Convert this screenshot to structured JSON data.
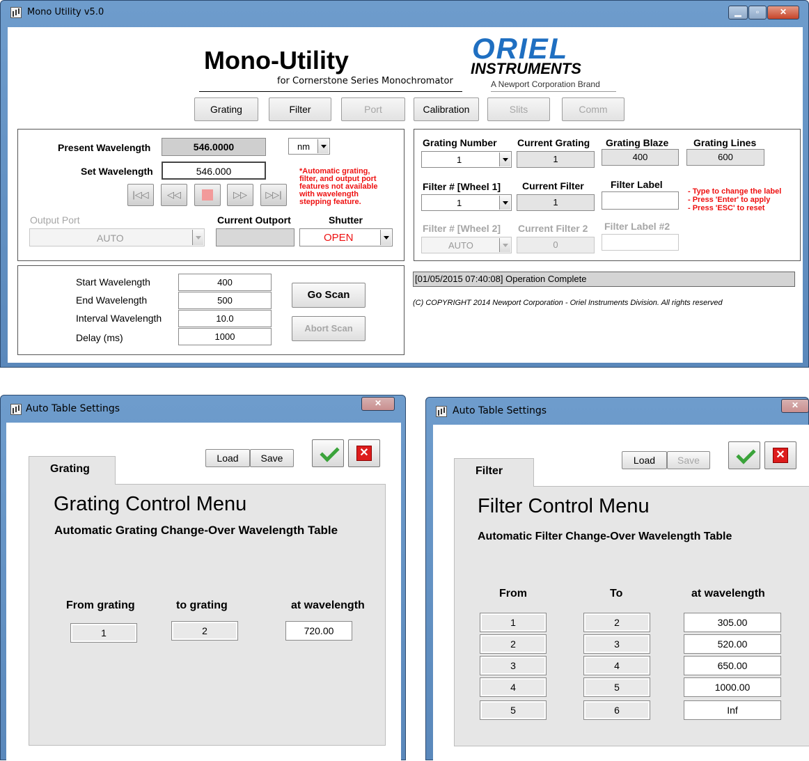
{
  "main_window": {
    "title": "Mono Utility v5.0",
    "header": {
      "title": "Mono-Utility",
      "subtitle": "for Cornerstone Series Monochromator"
    },
    "brand": {
      "name1": "ORIEL",
      "name2": "INSTRUMENTS",
      "tagline": "A Newport Corporation Brand"
    },
    "nav": [
      "Grating",
      "Filter",
      "Port",
      "Calibration",
      "Slits",
      "Comm"
    ],
    "wavelength": {
      "present_label": "Present Wavelength",
      "present_value": "546.0000",
      "unit": "nm",
      "set_label": "Set Wavelength",
      "set_value": "546.000",
      "note": "*Automatic grating, filter, and output port features not available with wavelength stepping feature.",
      "nav_icons": [
        "first-icon",
        "rewind-icon",
        "stop-icon",
        "forward-icon",
        "last-icon"
      ],
      "output_port_label": "Output Port",
      "output_port_value": "AUTO",
      "current_outport_label": "Current Outport",
      "current_outport_value": "",
      "shutter_label": "Shutter",
      "shutter_value": "OPEN"
    },
    "scan": {
      "start_label": "Start Wavelength",
      "start_value": "400",
      "end_label": "End Wavelength",
      "end_value": "500",
      "interval_label": "Interval Wavelength",
      "interval_value": "10.0",
      "delay_label": "Delay (ms)",
      "delay_value": "1000",
      "go_label": "Go Scan",
      "abort_label": "Abort Scan"
    },
    "grating": {
      "number_label": "Grating Number",
      "number_value": "1",
      "current_label": "Current Grating",
      "current_value": "1",
      "blaze_label": "Grating Blaze",
      "blaze_value": "400",
      "lines_label": "Grating Lines",
      "lines_value": "600"
    },
    "filter": {
      "wheel1_label": "Filter # [Wheel 1]",
      "wheel1_value": "1",
      "current_label": "Current Filter",
      "current_value": "1",
      "filter_label_label": "Filter Label",
      "filter_label_value": "",
      "hints": [
        "- Type to change the label",
        "- Press 'Enter' to apply",
        "- Press 'ESC' to reset"
      ],
      "wheel2_label": "Filter # [Wheel 2]",
      "wheel2_value": "AUTO",
      "current2_label": "Current Filter 2",
      "current2_value": "0",
      "label2_label": "Filter Label #2",
      "label2_value": ""
    },
    "status": "[01/05/2015  07:40:08]  Operation Complete",
    "copyright": "(C) COPYRIGHT 2014   Newport Corporation - Oriel Instruments Division. All rights reserved"
  },
  "grating_window": {
    "title": "Auto Table Settings",
    "tab": "Grating",
    "load": "Load",
    "save": "Save",
    "heading": "Grating Control Menu",
    "subheading": "Automatic Grating Change-Over Wavelength Table",
    "columns": [
      "From grating",
      "to grating",
      "at wavelength"
    ],
    "row": {
      "from": "1",
      "to": "2",
      "wavelength": "720.00"
    }
  },
  "filter_window": {
    "title": "Auto Table Settings",
    "tab": "Filter",
    "load": "Load",
    "save": "Save",
    "heading": "Filter Control Menu",
    "subheading": "Automatic Filter Change-Over  Wavelength Table",
    "columns": [
      "From",
      "To",
      "at wavelength"
    ],
    "rows": [
      {
        "from": "1",
        "to": "2",
        "wavelength": "305.00"
      },
      {
        "from": "2",
        "to": "3",
        "wavelength": "520.00"
      },
      {
        "from": "3",
        "to": "4",
        "wavelength": "650.00"
      },
      {
        "from": "4",
        "to": "5",
        "wavelength": "1000.00"
      },
      {
        "from": "5",
        "to": "6",
        "wavelength": "Inf"
      }
    ]
  },
  "colors": {
    "title_bar": "#5f8fc3",
    "red_text": "#ee1111",
    "status_bg": "#d4d4d4"
  }
}
